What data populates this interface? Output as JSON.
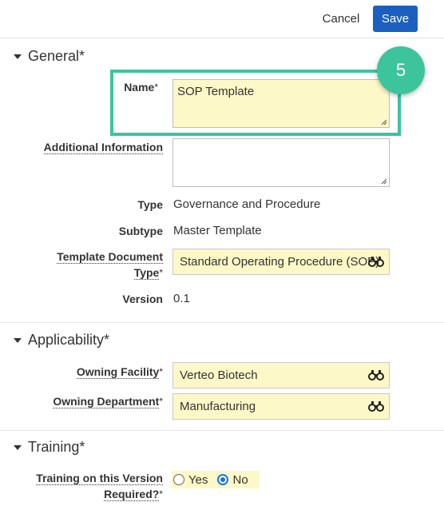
{
  "toolbar": {
    "cancel_label": "Cancel",
    "save_label": "Save"
  },
  "step_badge": "5",
  "sections": {
    "general": {
      "title": "General*",
      "name_label": "Name",
      "name_value": "SOP Template",
      "additional_info_label": "Additional Information",
      "additional_info_value": "",
      "type_label": "Type",
      "type_value": "Governance and Procedure",
      "subtype_label": "Subtype",
      "subtype_value": "Master Template",
      "template_doc_type_label_1": "Template Document",
      "template_doc_type_label_2": "Type",
      "template_doc_type_value": "Standard Operating Procedure (SOP)",
      "version_label": "Version",
      "version_value": "0.1"
    },
    "applicability": {
      "title": "Applicability*",
      "owning_facility_label": "Owning Facility",
      "owning_facility_value": "Verteo Biotech",
      "owning_department_label": "Owning Department",
      "owning_department_value": "Manufacturing"
    },
    "training": {
      "title": "Training*",
      "training_label_1": "Training on this Version",
      "training_label_2": "Required?",
      "option_yes": "Yes",
      "option_no": "No",
      "selected": "No"
    }
  },
  "required_marker": "*",
  "colors": {
    "accent": "#3cc49d",
    "primary_button": "#1b5fbf",
    "field_required_bg": "#fdf8c7"
  },
  "icons": {
    "lookup": "binoculars-icon",
    "section_toggle": "caret-down-icon"
  }
}
